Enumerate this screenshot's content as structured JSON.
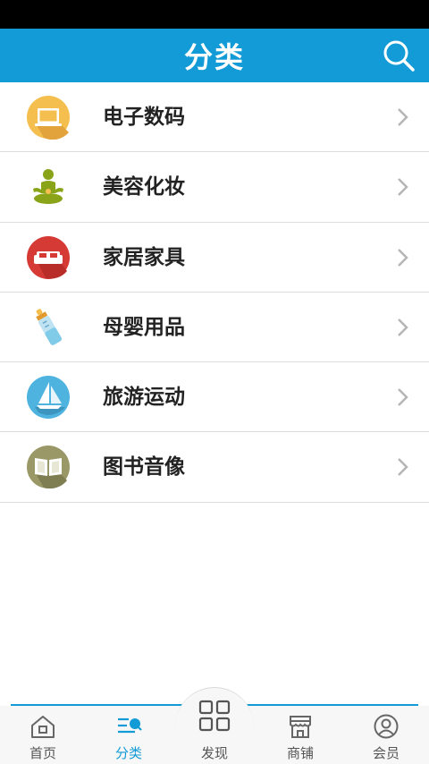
{
  "header": {
    "title": "分类"
  },
  "categories": [
    {
      "label": "电子数码",
      "icon": "laptop-icon",
      "color": "#f5bf4f"
    },
    {
      "label": "美容化妆",
      "icon": "meditation-person-icon",
      "color": "#8aa41a"
    },
    {
      "label": "家居家具",
      "icon": "sofa-icon",
      "color": "#d63a35"
    },
    {
      "label": "母婴用品",
      "icon": "baby-bottle-icon",
      "color": "#7fcbe8"
    },
    {
      "label": "旅游运动",
      "icon": "sailboat-icon",
      "color": "#4fb3df"
    },
    {
      "label": "图书音像",
      "icon": "book-icon",
      "color": "#9a9867"
    }
  ],
  "tabbar": {
    "active": "分类",
    "accent_color": "#129bd6",
    "items": [
      {
        "label": "首页",
        "icon": "home-icon"
      },
      {
        "label": "分类",
        "icon": "category-icon"
      },
      {
        "label": "发现",
        "icon": "grid-icon"
      },
      {
        "label": "商铺",
        "icon": "shop-icon"
      },
      {
        "label": "会员",
        "icon": "user-icon"
      }
    ]
  }
}
